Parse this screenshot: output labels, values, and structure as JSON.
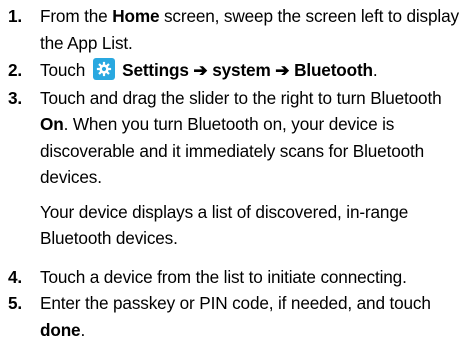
{
  "steps": [
    {
      "number": "1.",
      "t1": "From the ",
      "home": "Home",
      "t2": " screen, sweep the screen left to display the App List."
    },
    {
      "number": "2.",
      "t1": "Touch",
      "icon": "settings-gear-icon",
      "path": "Settings ➔ system ➔ Bluetooth",
      "t2": "."
    },
    {
      "number": "3.",
      "t1": "Touch and drag the slider to the right to turn Bluetooth ",
      "on": "On",
      "t2": ". When you turn Bluetooth on, your device is discoverable and it immediately scans for Bluetooth devices.",
      "sub": "Your device displays a list of discovered, in-range Bluetooth devices."
    },
    {
      "number": "4.",
      "t1": "Touch a device from the list to initiate connecting."
    },
    {
      "number": "5.",
      "t1": "Enter the passkey or PIN code, if needed, and touch ",
      "done": "done",
      "t2": "."
    }
  ],
  "colors": {
    "icon_background": "#29a8e0",
    "text": "#000000"
  }
}
